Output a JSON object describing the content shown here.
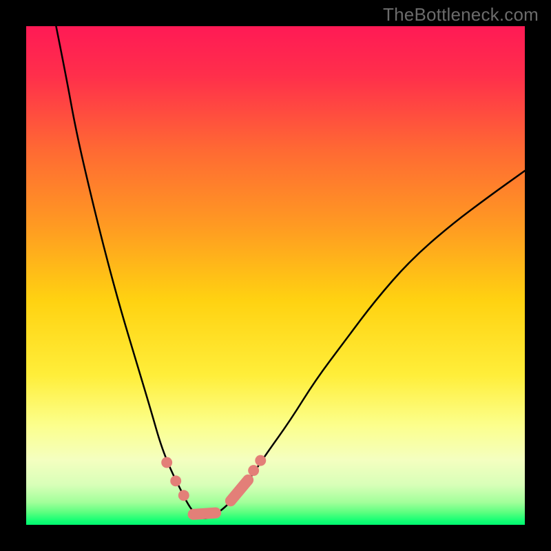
{
  "watermark": "TheBottleneck.com",
  "chart_data": {
    "type": "line",
    "title": "",
    "xlabel": "",
    "ylabel": "",
    "xlim": [
      0,
      100
    ],
    "ylim": [
      0,
      100
    ],
    "grid": false,
    "legend": false,
    "gradient_stops": [
      {
        "offset": 0.0,
        "color": "#ff1a55"
      },
      {
        "offset": 0.1,
        "color": "#ff2f4b"
      },
      {
        "offset": 0.25,
        "color": "#ff6a33"
      },
      {
        "offset": 0.4,
        "color": "#ff9a22"
      },
      {
        "offset": 0.55,
        "color": "#ffd211"
      },
      {
        "offset": 0.7,
        "color": "#ffee3a"
      },
      {
        "offset": 0.8,
        "color": "#fcff8c"
      },
      {
        "offset": 0.87,
        "color": "#f4ffc0"
      },
      {
        "offset": 0.92,
        "color": "#d8ffb8"
      },
      {
        "offset": 0.955,
        "color": "#a2ff9a"
      },
      {
        "offset": 0.975,
        "color": "#5cff80"
      },
      {
        "offset": 0.99,
        "color": "#1aff75"
      },
      {
        "offset": 1.0,
        "color": "#00f770"
      }
    ],
    "series": [
      {
        "name": "bottleneck-curve",
        "x": [
          6,
          8,
          10,
          13,
          16,
          19,
          22,
          25,
          27,
          29,
          31,
          32.5,
          34,
          35.5,
          37,
          40,
          44,
          48,
          53,
          58,
          64,
          70,
          77,
          85,
          93,
          100
        ],
        "y": [
          100,
          90,
          79,
          66,
          54,
          43,
          33,
          23,
          16,
          11,
          7,
          4,
          2,
          1.2,
          1.5,
          3.5,
          8,
          14,
          21,
          29,
          37,
          45,
          53,
          60,
          66,
          71
        ],
        "color": "#000000"
      }
    ],
    "markers": [
      {
        "shape": "dot",
        "cx": 28.2,
        "cy": 12.5,
        "r": 1.1,
        "color": "#e37f78"
      },
      {
        "shape": "dot",
        "cx": 30.0,
        "cy": 8.8,
        "r": 1.1,
        "color": "#e37f78"
      },
      {
        "shape": "dot",
        "cx": 31.6,
        "cy": 5.9,
        "r": 1.1,
        "color": "#e37f78"
      },
      {
        "shape": "pill",
        "x1": 33.5,
        "y1": 2.1,
        "x2": 38.0,
        "y2": 2.4,
        "w": 2.2,
        "color": "#e37f78"
      },
      {
        "shape": "pill",
        "x1": 41.0,
        "y1": 4.8,
        "x2": 44.5,
        "y2": 9.0,
        "w": 2.2,
        "color": "#e37f78"
      },
      {
        "shape": "dot",
        "cx": 45.6,
        "cy": 10.9,
        "r": 1.1,
        "color": "#e37f78"
      },
      {
        "shape": "dot",
        "cx": 47.0,
        "cy": 12.9,
        "r": 1.1,
        "color": "#e37f78"
      }
    ]
  }
}
